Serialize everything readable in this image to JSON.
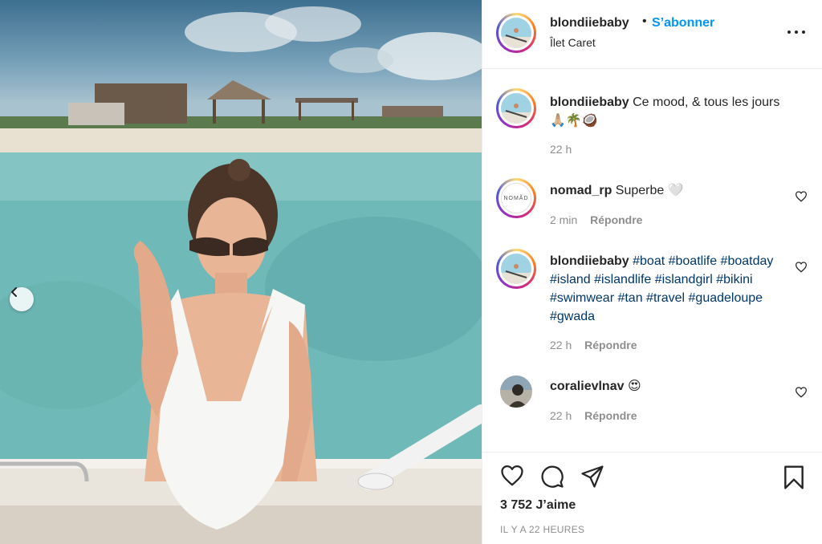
{
  "post": {
    "author": "blondiiebaby",
    "follow_label": "S’abonner",
    "separator": "•",
    "location": "Îlet Caret",
    "caption_text": "Ce mood, & tous les jours 🙏🏼🌴🥥",
    "caption_time": "22 h",
    "likes": "3 752 J’aime",
    "time_ago": "IL Y A 22 HEURES"
  },
  "comments": [
    {
      "username": "nomad_rp",
      "text": "Superbe 🤍",
      "time": "2 min",
      "reply_label": "Répondre",
      "avatar_text": "NOMÃD"
    },
    {
      "username": "blondiiebaby",
      "hashtags": "#boat #boatlife #boatday #island #islandlife #islandgirl #bikini #swimwear #tan #travel #guadeloupe #gwada",
      "time": "22 h",
      "reply_label": "Répondre"
    },
    {
      "username": "coralievlnav",
      "text": "😍",
      "time": "22 h",
      "reply_label": "Répondre"
    }
  ],
  "icons": {
    "more": "more-options-icon",
    "like": "heart-icon",
    "comment": "comment-bubble-icon",
    "share": "paper-plane-icon",
    "save": "bookmark-icon",
    "prev": "chevron-left-icon"
  },
  "colors": {
    "accent": "#0095f6",
    "hashtag": "#00376b",
    "muted": "#8e8e8e",
    "text": "#262626"
  }
}
